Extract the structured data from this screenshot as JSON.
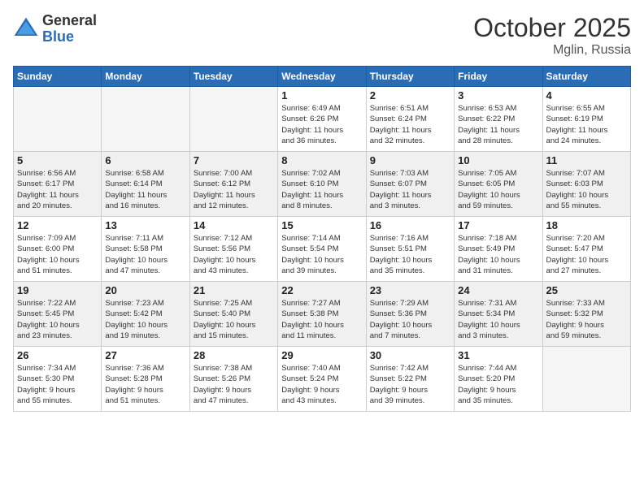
{
  "logo": {
    "general": "General",
    "blue": "Blue"
  },
  "title": "October 2025",
  "location": "Mglin, Russia",
  "days_header": [
    "Sunday",
    "Monday",
    "Tuesday",
    "Wednesday",
    "Thursday",
    "Friday",
    "Saturday"
  ],
  "weeks": [
    [
      {
        "day": "",
        "info": "",
        "empty": true
      },
      {
        "day": "",
        "info": "",
        "empty": true
      },
      {
        "day": "",
        "info": "",
        "empty": true
      },
      {
        "day": "1",
        "info": "Sunrise: 6:49 AM\nSunset: 6:26 PM\nDaylight: 11 hours\nand 36 minutes."
      },
      {
        "day": "2",
        "info": "Sunrise: 6:51 AM\nSunset: 6:24 PM\nDaylight: 11 hours\nand 32 minutes."
      },
      {
        "day": "3",
        "info": "Sunrise: 6:53 AM\nSunset: 6:22 PM\nDaylight: 11 hours\nand 28 minutes."
      },
      {
        "day": "4",
        "info": "Sunrise: 6:55 AM\nSunset: 6:19 PM\nDaylight: 11 hours\nand 24 minutes."
      }
    ],
    [
      {
        "day": "5",
        "info": "Sunrise: 6:56 AM\nSunset: 6:17 PM\nDaylight: 11 hours\nand 20 minutes.",
        "shaded": true
      },
      {
        "day": "6",
        "info": "Sunrise: 6:58 AM\nSunset: 6:14 PM\nDaylight: 11 hours\nand 16 minutes.",
        "shaded": true
      },
      {
        "day": "7",
        "info": "Sunrise: 7:00 AM\nSunset: 6:12 PM\nDaylight: 11 hours\nand 12 minutes.",
        "shaded": true
      },
      {
        "day": "8",
        "info": "Sunrise: 7:02 AM\nSunset: 6:10 PM\nDaylight: 11 hours\nand 8 minutes.",
        "shaded": true
      },
      {
        "day": "9",
        "info": "Sunrise: 7:03 AM\nSunset: 6:07 PM\nDaylight: 11 hours\nand 3 minutes.",
        "shaded": true
      },
      {
        "day": "10",
        "info": "Sunrise: 7:05 AM\nSunset: 6:05 PM\nDaylight: 10 hours\nand 59 minutes.",
        "shaded": true
      },
      {
        "day": "11",
        "info": "Sunrise: 7:07 AM\nSunset: 6:03 PM\nDaylight: 10 hours\nand 55 minutes.",
        "shaded": true
      }
    ],
    [
      {
        "day": "12",
        "info": "Sunrise: 7:09 AM\nSunset: 6:00 PM\nDaylight: 10 hours\nand 51 minutes."
      },
      {
        "day": "13",
        "info": "Sunrise: 7:11 AM\nSunset: 5:58 PM\nDaylight: 10 hours\nand 47 minutes."
      },
      {
        "day": "14",
        "info": "Sunrise: 7:12 AM\nSunset: 5:56 PM\nDaylight: 10 hours\nand 43 minutes."
      },
      {
        "day": "15",
        "info": "Sunrise: 7:14 AM\nSunset: 5:54 PM\nDaylight: 10 hours\nand 39 minutes."
      },
      {
        "day": "16",
        "info": "Sunrise: 7:16 AM\nSunset: 5:51 PM\nDaylight: 10 hours\nand 35 minutes."
      },
      {
        "day": "17",
        "info": "Sunrise: 7:18 AM\nSunset: 5:49 PM\nDaylight: 10 hours\nand 31 minutes."
      },
      {
        "day": "18",
        "info": "Sunrise: 7:20 AM\nSunset: 5:47 PM\nDaylight: 10 hours\nand 27 minutes."
      }
    ],
    [
      {
        "day": "19",
        "info": "Sunrise: 7:22 AM\nSunset: 5:45 PM\nDaylight: 10 hours\nand 23 minutes.",
        "shaded": true
      },
      {
        "day": "20",
        "info": "Sunrise: 7:23 AM\nSunset: 5:42 PM\nDaylight: 10 hours\nand 19 minutes.",
        "shaded": true
      },
      {
        "day": "21",
        "info": "Sunrise: 7:25 AM\nSunset: 5:40 PM\nDaylight: 10 hours\nand 15 minutes.",
        "shaded": true
      },
      {
        "day": "22",
        "info": "Sunrise: 7:27 AM\nSunset: 5:38 PM\nDaylight: 10 hours\nand 11 minutes.",
        "shaded": true
      },
      {
        "day": "23",
        "info": "Sunrise: 7:29 AM\nSunset: 5:36 PM\nDaylight: 10 hours\nand 7 minutes.",
        "shaded": true
      },
      {
        "day": "24",
        "info": "Sunrise: 7:31 AM\nSunset: 5:34 PM\nDaylight: 10 hours\nand 3 minutes.",
        "shaded": true
      },
      {
        "day": "25",
        "info": "Sunrise: 7:33 AM\nSunset: 5:32 PM\nDaylight: 9 hours\nand 59 minutes.",
        "shaded": true
      }
    ],
    [
      {
        "day": "26",
        "info": "Sunrise: 7:34 AM\nSunset: 5:30 PM\nDaylight: 9 hours\nand 55 minutes."
      },
      {
        "day": "27",
        "info": "Sunrise: 7:36 AM\nSunset: 5:28 PM\nDaylight: 9 hours\nand 51 minutes."
      },
      {
        "day": "28",
        "info": "Sunrise: 7:38 AM\nSunset: 5:26 PM\nDaylight: 9 hours\nand 47 minutes."
      },
      {
        "day": "29",
        "info": "Sunrise: 7:40 AM\nSunset: 5:24 PM\nDaylight: 9 hours\nand 43 minutes."
      },
      {
        "day": "30",
        "info": "Sunrise: 7:42 AM\nSunset: 5:22 PM\nDaylight: 9 hours\nand 39 minutes."
      },
      {
        "day": "31",
        "info": "Sunrise: 7:44 AM\nSunset: 5:20 PM\nDaylight: 9 hours\nand 35 minutes."
      },
      {
        "day": "",
        "info": "",
        "empty": true
      }
    ]
  ]
}
